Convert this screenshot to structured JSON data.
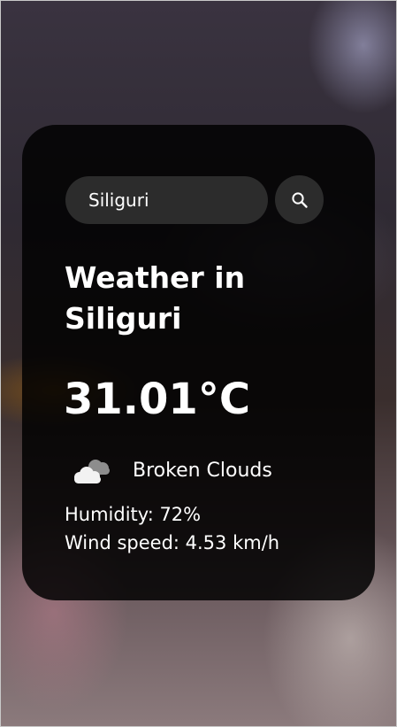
{
  "search": {
    "value": "Siliguri",
    "icon": "search-icon"
  },
  "weather": {
    "title": "Weather in Siliguri",
    "temperature": "31.01°C",
    "condition": "Broken Clouds",
    "condition_icon": "broken-clouds-icon",
    "humidity": "Humidity: 72%",
    "wind": "Wind speed: 4.53 km/h"
  },
  "colors": {
    "card_background": "#000000",
    "input_background": "#2c2c2c",
    "text": "#ffffff"
  }
}
